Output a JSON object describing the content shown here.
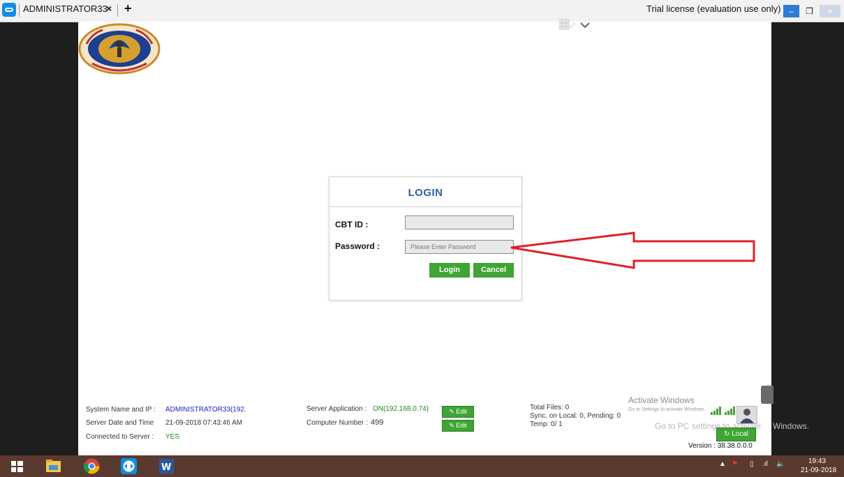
{
  "teamviewer": {
    "tab_title": "ADMINISTRATOR33",
    "tab_close": "×",
    "new_tab": "+",
    "license_text": "Trial license (evaluation use only)",
    "minimize": "–",
    "restore": "❐",
    "close": "×"
  },
  "login": {
    "title": "LOGIN",
    "cbt_label": "CBT ID :",
    "cbt_value": "",
    "password_label": "Password :",
    "password_placeholder": "Please Enter Password",
    "login_button": "Login",
    "cancel_button": "Cancel"
  },
  "footer": {
    "system_label": "System Name and IP :",
    "system_value": "ADMINISTRATOR33(192.",
    "date_label": "Server Date and Time",
    "date_value": "21-09-2018 07:43:46 AM",
    "connected_label": "Connected to Server :",
    "connected_value": "YES",
    "server_app_label": "Server Application :",
    "server_app_value": "ON(192.168.0.74)",
    "computer_label": "Computer Number :",
    "computer_value": "499",
    "edit_label": "Edit",
    "total_files": "Total Files: 0",
    "sync": "Sync. on Local: 0, Pending: 0",
    "temp": "Temp: 0/ 1",
    "local_button": "Local",
    "version": "Version : 38.38.0.0.0"
  },
  "watermark": {
    "line1": "Activate Windows",
    "line2": "Go to Settings to activate Windows.",
    "line3": "Go to PC settings to activate",
    "line4": "Windows."
  },
  "taskbar": {
    "time": "19:43",
    "date": "21-09-2018"
  },
  "colors": {
    "accent_green": "#3fa535",
    "title_blue": "#2e5ea3",
    "arrow_red": "#e0202a",
    "taskbar": "#5a3a2e"
  }
}
